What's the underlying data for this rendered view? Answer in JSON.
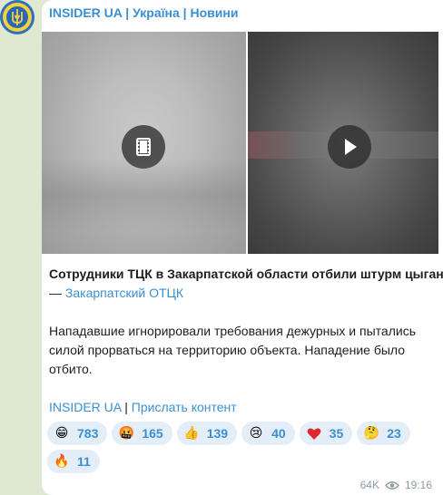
{
  "channel": {
    "name": "INSIDER UA",
    "separator_1": " | ",
    "tag_1": "Україна",
    "separator_2": " | ",
    "tag_2": "Новини"
  },
  "media": {
    "video_1_icon": "film-icon",
    "video_2_icon": "play-icon"
  },
  "post": {
    "headline": "Сотрудники ТЦК в Закарпатской области отбили штурм цыган,",
    "source_prefix": "— ",
    "source_link": "Закарпатский ОТЦК",
    "paragraph": "Нападавшие игнорировали требования дежурных и пытались силой прорваться на территорию объекта. Нападение было отбито.",
    "footer_link_1": "INSIDER UA",
    "footer_sep": " | ",
    "footer_link_2": "Прислать контент"
  },
  "reactions": [
    {
      "emoji": "😁",
      "icon": "grin-emoji",
      "count": "783"
    },
    {
      "emoji": "🤬",
      "icon": "angry-emoji",
      "count": "165"
    },
    {
      "emoji": "👍",
      "icon": "thumbs-up-emoji",
      "count": "139"
    },
    {
      "emoji": "😢",
      "icon": "crying-emoji",
      "count": "40"
    },
    {
      "emoji": "❤",
      "icon": "heart-emoji",
      "count": "35"
    },
    {
      "emoji": "🤔",
      "icon": "thinking-emoji",
      "count": "23"
    },
    {
      "emoji": "🔥",
      "icon": "fire-emoji",
      "count": "11"
    }
  ],
  "meta": {
    "views": "64K",
    "time": "19:16"
  },
  "colors": {
    "accent": "#3a8fd1",
    "background": "#dfe9d2",
    "reaction_bg": "#e3eef8"
  }
}
